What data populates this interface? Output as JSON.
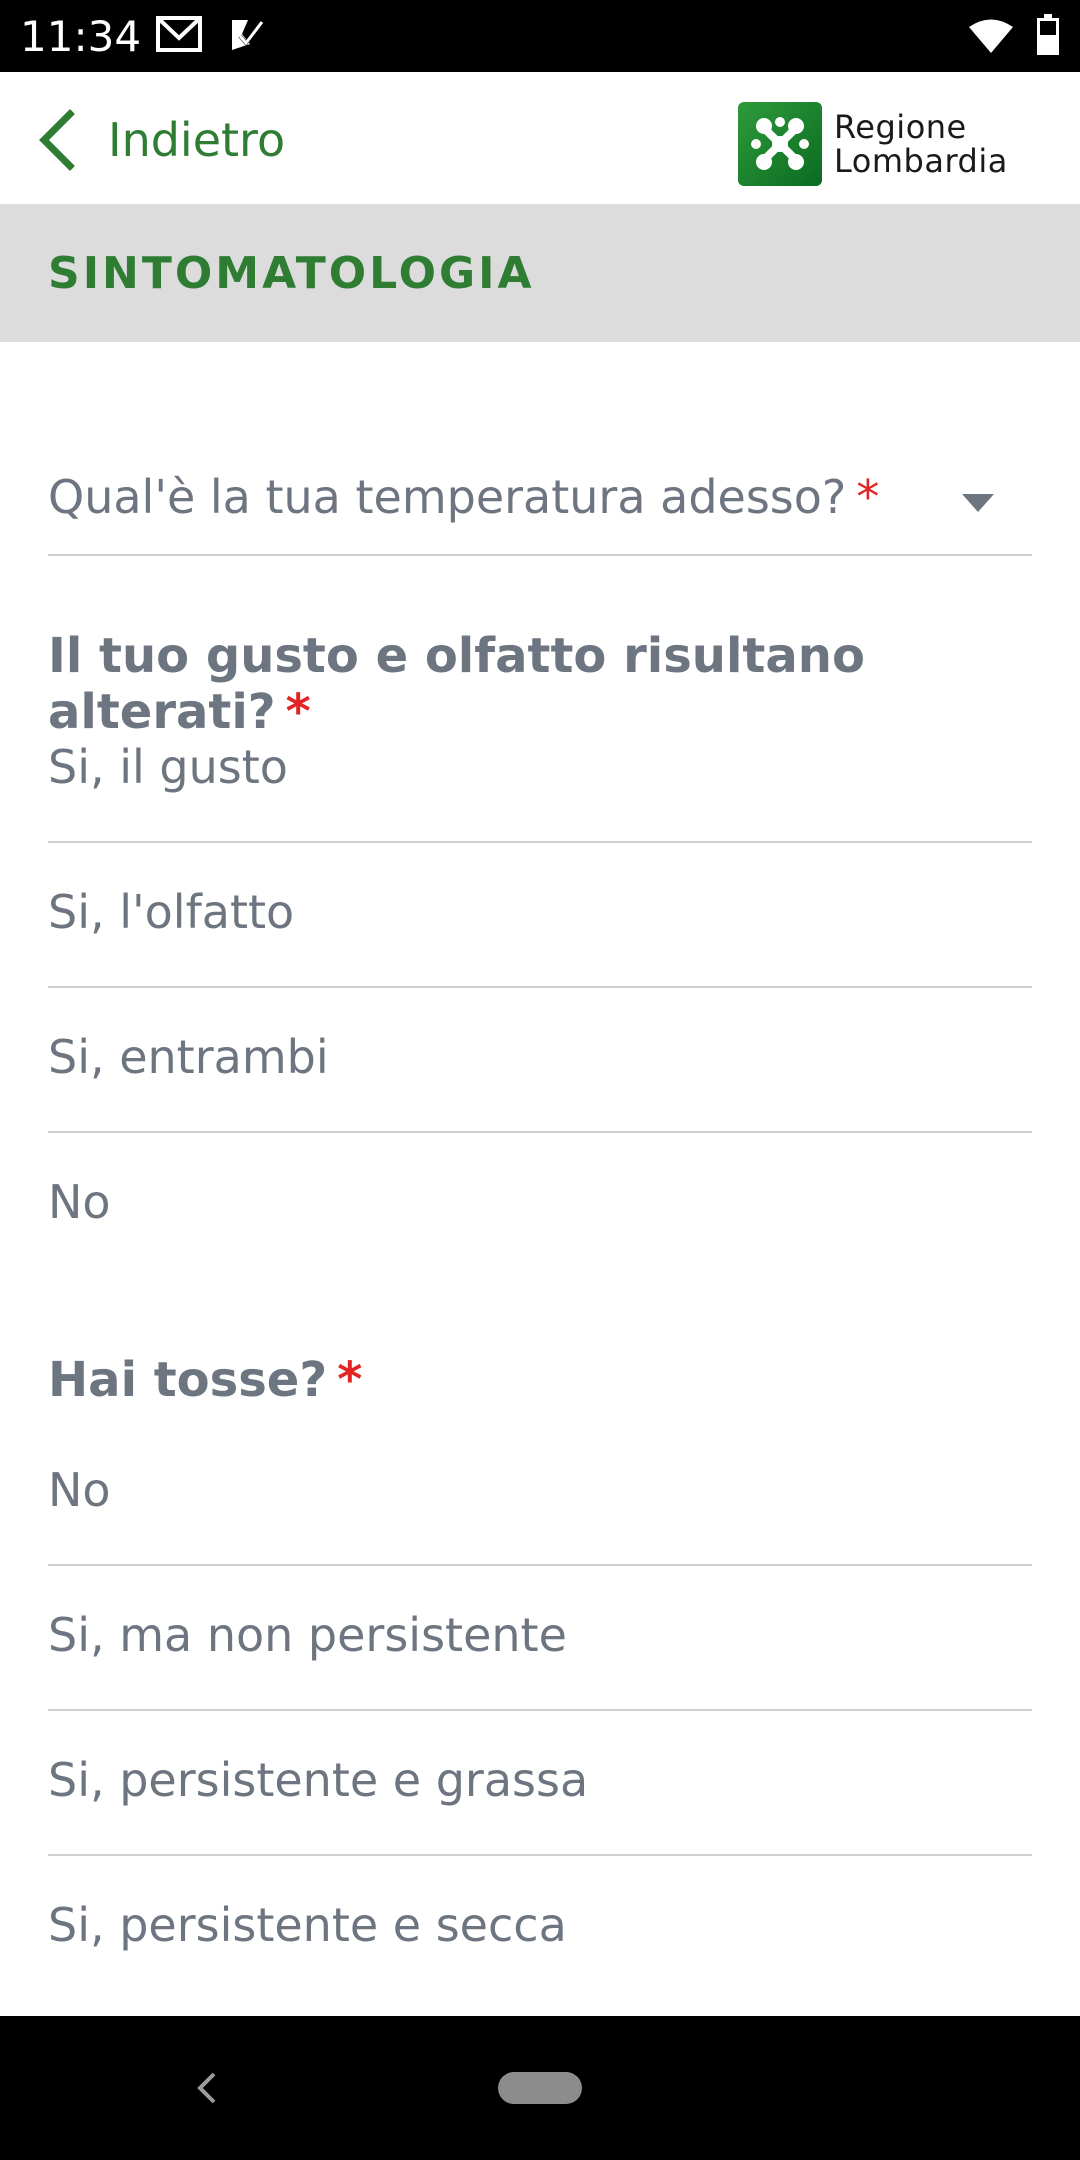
{
  "status_bar": {
    "time": "11:34",
    "icons": [
      "gmail-icon",
      "task-check-icon",
      "wifi-icon",
      "battery-icon"
    ]
  },
  "header": {
    "back_label": "Indietro",
    "back_icon": "chevron-left-icon",
    "logo_line1": "Regione",
    "logo_line2": "Lombardia",
    "accent_color": "#2e7d32"
  },
  "section": {
    "title": "SINTOMATOLOGIA"
  },
  "temperature": {
    "label": "Qual'è la tua temperatura adesso?",
    "required_mark": "*"
  },
  "question_taste": {
    "label": "Il tuo gusto e olfatto risultano alterati?",
    "required_mark": "*",
    "options": [
      "Si, il gusto",
      "Si, l'olfatto",
      "Si, entrambi",
      "No"
    ]
  },
  "question_cough": {
    "label": "Hai tosse?",
    "required_mark": "*",
    "options": [
      "No",
      "Si, ma non persistente",
      "Si, persistente e grassa",
      "Si, persistente e secca"
    ]
  },
  "colors": {
    "required": "#e32424",
    "text_muted": "#6d7580",
    "section_bg": "#dcdcdc"
  }
}
